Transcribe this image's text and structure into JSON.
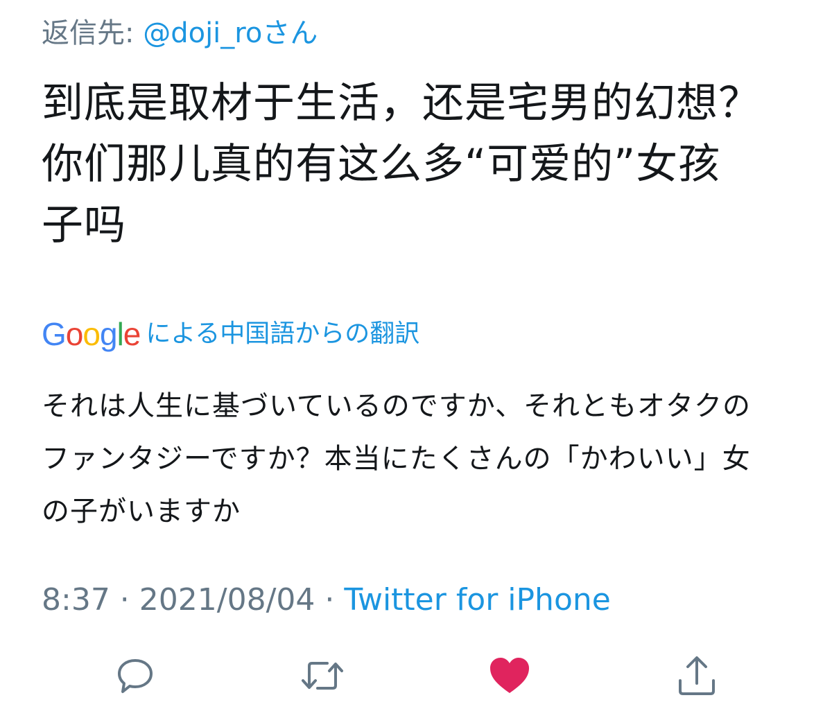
{
  "reply_to": {
    "prefix": "返信先:",
    "handle": "@doji_roさん"
  },
  "tweet": {
    "text": "到底是取材于生活，还是宅男的幻想？你们那儿真的有这么多“可爱的”女孩子吗"
  },
  "translation": {
    "logo_letters": [
      "G",
      "o",
      "o",
      "g",
      "l",
      "e"
    ],
    "label": "による中国語からの翻訳",
    "text": "それは人生に基づいているのですか、それともオタクのファンタジーですか？本当にたくさんの「かわいい」女の子がいますか"
  },
  "meta": {
    "time": "8:37",
    "separator1": " · ",
    "date": "2021/08/04",
    "separator2": " · ",
    "source": "Twitter for iPhone"
  },
  "actions": {
    "reply_icon": "reply-icon",
    "retweet_icon": "retweet-icon",
    "like_icon": "heart-icon",
    "share_icon": "share-icon",
    "like_active": true
  },
  "colors": {
    "link": "#1b95e0",
    "muted": "#657786",
    "text": "#14171a",
    "like": "#e0245e",
    "icon": "#657786"
  }
}
